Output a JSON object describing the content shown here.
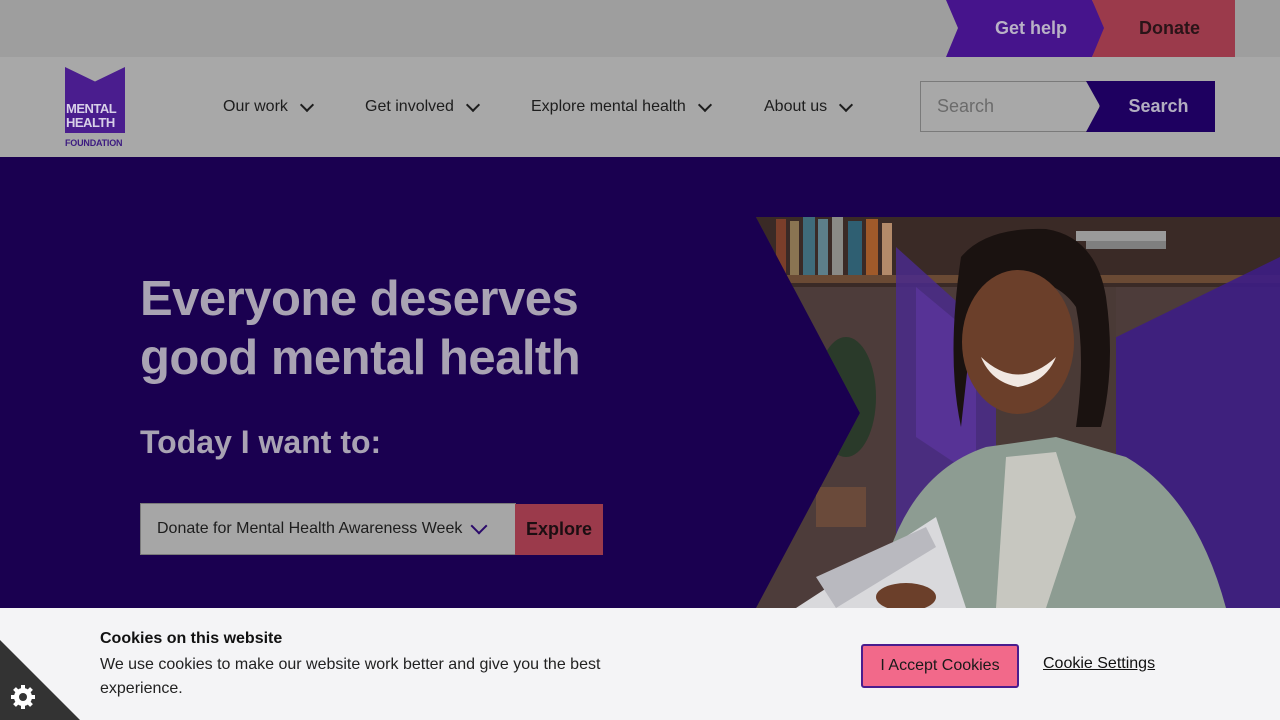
{
  "utility": {
    "get_help": "Get help",
    "donate": "Donate"
  },
  "logo": {
    "line1": "MENTAL",
    "line2": "HEALTH",
    "line3": "FOUNDATION"
  },
  "nav": {
    "items": [
      {
        "label": "Our work"
      },
      {
        "label": "Get involved"
      },
      {
        "label": "Explore mental health"
      },
      {
        "label": "About us"
      }
    ]
  },
  "search": {
    "placeholder": "Search",
    "button": "Search"
  },
  "hero": {
    "title": "Everyone deserves good mental health",
    "subtitle": "Today I want to:",
    "select_value": "Donate for Mental Health Awareness Week",
    "explore": "Explore"
  },
  "cookies": {
    "title": "Cookies on this website",
    "text": "We use cookies to make our website work better and give you the best experience.",
    "accept": "I Accept Cookies",
    "settings": "Cookie Settings"
  },
  "colors": {
    "brand_purple": "#46148c",
    "hero_bg": "#1a0050",
    "donate_red": "#9b3a4b",
    "accept_pink": "#f2698a"
  }
}
